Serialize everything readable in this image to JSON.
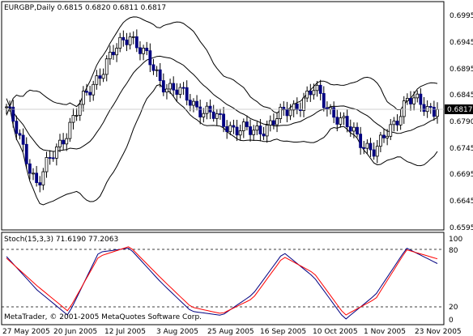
{
  "header": {
    "symbol_line": "EURGBP,Daily  0.6815 0.6820 0.6811 0.6817"
  },
  "price_axis": {
    "labels": [
      "0.6995",
      "0.6945",
      "0.6895",
      "0.6845",
      "0.6790",
      "0.6745",
      "0.6695",
      "0.6645",
      "0.6595"
    ],
    "current_price": "0.6817"
  },
  "stoch_panel": {
    "title": "Stoch(15,3,3) 71.6190 77.2063",
    "levels": [
      "100",
      "80",
      "20",
      "0"
    ]
  },
  "time_axis": {
    "labels": [
      "27 May 2005",
      "20 Jun 2005",
      "12 Jul 2005",
      "3 Aug 2005",
      "25 Aug 2005",
      "16 Sep 2005",
      "10 Oct 2005",
      "1 Nov 2005",
      "23 Nov 2005"
    ]
  },
  "copyright": "MetaTrader, © 2001-2005 MetaQuotes Software Corp.",
  "colors": {
    "background": "#ffffff",
    "candle_up": "#ffffff",
    "candle_down": "#000080",
    "wick": "#000000",
    "bands": "#000000",
    "stoch_main": "#000080",
    "stoch_signal": "#ff0000",
    "price_highlight": "#000000",
    "grid_dashed": "#000000"
  },
  "chart_data": [
    {
      "type": "candlestick",
      "title": "EURGBP,Daily",
      "ylim": [
        0.659,
        0.702
      ],
      "x": [
        "27 May 2005",
        "20 Jun 2005",
        "12 Jul 2005",
        "3 Aug 2005",
        "25 Aug 2005",
        "16 Sep 2005",
        "10 Oct 2005",
        "1 Nov 2005",
        "23 Nov 2005"
      ],
      "close": [
        0.6822,
        0.6674,
        0.6782,
        0.6886,
        0.6964,
        0.6873,
        0.6832,
        0.6792,
        0.6771,
        0.6807,
        0.6853,
        0.6786,
        0.6734,
        0.6835,
        0.6817
      ],
      "last": 0.6817,
      "indicators": [
        "Bollinger Bands"
      ]
    },
    {
      "type": "line",
      "title": "Stoch(15,3,3) 71.6190 77.2063",
      "ylim": [
        0,
        100
      ],
      "series": [
        {
          "name": "Stoch main",
          "values": [
            80,
            40,
            10,
            85,
            90,
            50,
            15,
            10,
            35,
            85,
            55,
            5,
            35,
            90,
            71.619
          ]
        },
        {
          "name": "Stoch signal",
          "values": [
            78,
            45,
            15,
            80,
            92,
            55,
            20,
            12,
            30,
            80,
            60,
            10,
            30,
            88,
            77.2063
          ]
        }
      ],
      "levels": [
        20,
        80
      ]
    }
  ]
}
